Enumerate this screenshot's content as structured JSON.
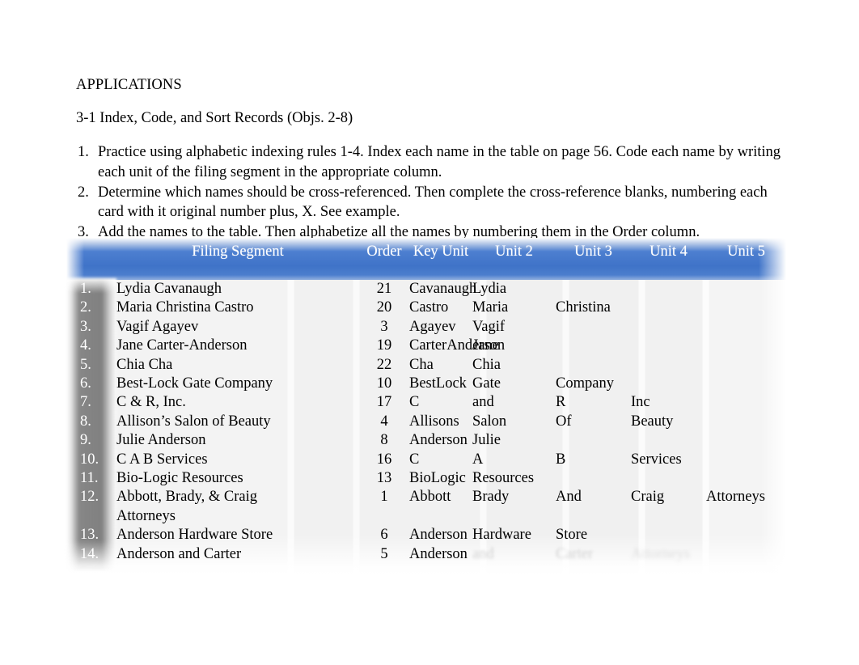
{
  "document": {
    "heading": "APPLICATIONS",
    "subheading": "3-1 Index, Code, and Sort Records (Objs. 2-8)",
    "tasks": [
      {
        "num": "1.",
        "text": "Practice using alphabetic indexing rules 1-4. Index each name in the table on page 56. Code each name by writing each unit of the filing segment in the appropriate column."
      },
      {
        "num": "2.",
        "text": "Determine which names should be cross-referenced. Then complete the cross-reference blanks, numbering each card with it original number plus, X. See example."
      },
      {
        "num": "3.",
        "text": "Add the names to the table. Then alphabetize all the names by numbering them in the Order column."
      }
    ]
  },
  "table": {
    "header_color": "#4275c8",
    "columns": [
      {
        "key": "rownum",
        "label": ""
      },
      {
        "key": "segment",
        "label": "Filing Segment"
      },
      {
        "key": "order",
        "label": "Order"
      },
      {
        "key": "key_unit",
        "label": "Key Unit"
      },
      {
        "key": "unit2",
        "label": "Unit 2"
      },
      {
        "key": "unit3",
        "label": "Unit 3"
      },
      {
        "key": "unit4",
        "label": "Unit 4"
      },
      {
        "key": "unit5",
        "label": "Unit 5"
      }
    ],
    "rows": [
      {
        "num": "1.",
        "segment": "Lydia Cavanaugh",
        "order": "21",
        "key_unit": "Cavanaugh",
        "unit2": "Lydia",
        "unit3": "",
        "unit4": "",
        "unit5": ""
      },
      {
        "num": "2.",
        "segment": "Maria Christina Castro",
        "order": "20",
        "key_unit": "Castro",
        "unit2": "Maria",
        "unit3": "Christina",
        "unit4": "",
        "unit5": ""
      },
      {
        "num": "3.",
        "segment": "Vagif Agayev",
        "order": "3",
        "key_unit": "Agayev",
        "unit2": "Vagif",
        "unit3": "",
        "unit4": "",
        "unit5": ""
      },
      {
        "num": "4.",
        "segment": "Jane Carter-Anderson",
        "order": "19",
        "key_unit": "CarterAnderson",
        "unit2": "Jane",
        "unit3": "",
        "unit4": "",
        "unit5": ""
      },
      {
        "num": "5.",
        "segment": "Chia Cha",
        "order": "22",
        "key_unit": "Cha",
        "unit2": "Chia",
        "unit3": "",
        "unit4": "",
        "unit5": ""
      },
      {
        "num": "6.",
        "segment": "Best-Lock Gate Company",
        "order": "10",
        "key_unit": "BestLock",
        "unit2": "Gate",
        "unit3": "Company",
        "unit4": "",
        "unit5": ""
      },
      {
        "num": "7.",
        "segment": "C & R, Inc.",
        "order": "17",
        "key_unit": "C",
        "unit2": "and",
        "unit3": "R",
        "unit4": "Inc",
        "unit5": ""
      },
      {
        "num": "8.",
        "segment": "Allison’s Salon of Beauty",
        "order": "4",
        "key_unit": "Allisons",
        "unit2": "Salon",
        "unit3": "Of",
        "unit4": "Beauty",
        "unit5": ""
      },
      {
        "num": "9.",
        "segment": "Julie Anderson",
        "order": "8",
        "key_unit": "Anderson",
        "unit2": "Julie",
        "unit3": "",
        "unit4": "",
        "unit5": ""
      },
      {
        "num": "10.",
        "segment": "C A B Services",
        "order": "16",
        "key_unit": "C",
        "unit2": "A",
        "unit3": "B",
        "unit4": "Services",
        "unit5": ""
      },
      {
        "num": "11.",
        "segment": "Bio-Logic Resources",
        "order": "13",
        "key_unit": "BioLogic",
        "unit2": "Resources",
        "unit3": "",
        "unit4": "",
        "unit5": ""
      },
      {
        "num": "12.",
        "segment": "Abbott, Brady, & Craig\nAttorneys",
        "order": "1",
        "key_unit": "Abbott",
        "unit2": "Brady",
        "unit3": "And",
        "unit4": "Craig",
        "unit5": "Attorneys"
      },
      {
        "num": "13.",
        "segment": "Anderson Hardware Store",
        "order": "6",
        "key_unit": "Anderson",
        "unit2": "Hardware",
        "unit3": "Store",
        "unit4": "",
        "unit5": ""
      },
      {
        "num": "14.",
        "segment": "Anderson and Carter",
        "order": "5",
        "key_unit": "Anderson",
        "unit2": "and",
        "unit3": "Carter",
        "unit4": "Attorneys",
        "unit5": ""
      }
    ]
  }
}
